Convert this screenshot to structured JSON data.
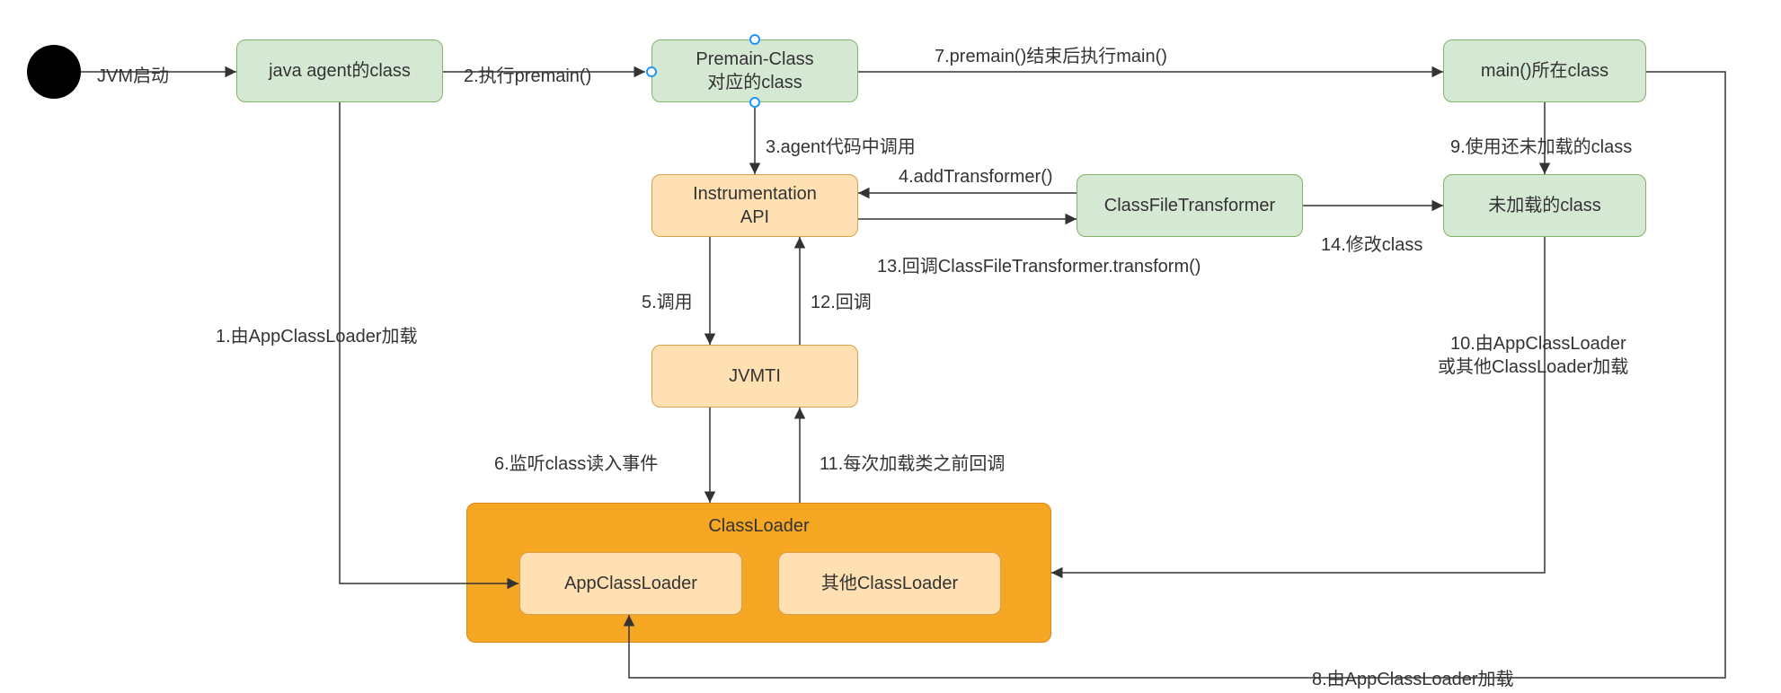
{
  "nodes": {
    "start": "JVM启动",
    "javaAgent": "java agent的class",
    "premainClass": "Premain-Class\n对应的class",
    "mainClass": "main()所在class",
    "instrApi": "Instrumentation\nAPI",
    "cft": "ClassFileTransformer",
    "unloaded": "未加载的class",
    "jvmti": "JVMTI",
    "classLoaderGroup": "ClassLoader",
    "appCL": "AppClassLoader",
    "otherCL": "其他ClassLoader"
  },
  "edges": {
    "e_start": "JVM启动",
    "e1": "1.由AppClassLoader加载",
    "e2": "2.执行premain()",
    "e3": "3.agent代码中调用",
    "e4": "4.addTransformer()",
    "e5": "5.调用",
    "e6": "6.监听class读入事件",
    "e7": "7.premain()结束后执行main()",
    "e8": "8.由AppClassLoader加载",
    "e9": "9.使用还未加载的class",
    "e10a": "10.由AppClassLoader",
    "e10b": "或其他ClassLoader加载",
    "e11": "11.每次加载类之前回调",
    "e12": "12.回调",
    "e13": "13.回调ClassFileTransformer.transform()",
    "e14": "14.修改class"
  }
}
